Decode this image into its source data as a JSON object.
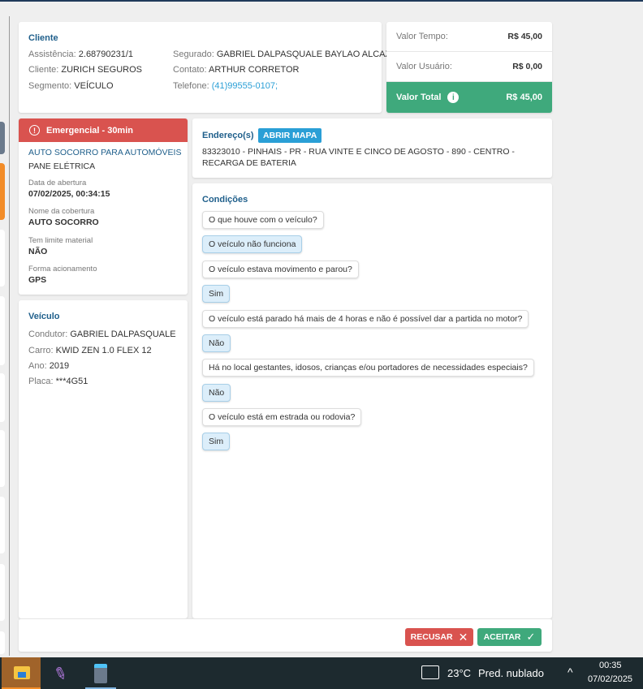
{
  "client": {
    "title": "Cliente",
    "fields": [
      {
        "label": "Assistência:",
        "value": "2.68790231/1"
      },
      {
        "label": "Cliente:",
        "value": "ZURICH SEGUROS"
      },
      {
        "label": "Segmento:",
        "value": "VEÍCULO"
      },
      {
        "label": "Segurado:",
        "value": "GABRIEL DALPASQUALE BAYLAO ALCAZAR"
      },
      {
        "label": "Contato:",
        "value": "ARTHUR CORRETOR"
      },
      {
        "label": "Telefone:",
        "value": "(41)99555-0107;"
      }
    ]
  },
  "values": {
    "tempo_label": "Valor Tempo:",
    "tempo": "R$ 45,00",
    "usuario_label": "Valor Usuário:",
    "usuario": "R$ 0,00",
    "total_label": "Valor Total",
    "total": "R$ 45,00"
  },
  "service": {
    "badge": "Emergencial - 30min",
    "title": "AUTO SOCORRO PARA AUTOMÓVEIS",
    "subtitle": "PANE ELÉTRICA",
    "fields": [
      {
        "label": "Data de abertura",
        "value": "07/02/2025, 00:34:15"
      },
      {
        "label": "Nome da cobertura",
        "value": "AUTO SOCORRO"
      },
      {
        "label": "Tem limite material",
        "value": "NÃO"
      },
      {
        "label": "Forma acionamento",
        "value": "GPS"
      }
    ]
  },
  "vehicle": {
    "title": "Veículo",
    "fields": [
      {
        "label": "Condutor:",
        "value": "GABRIEL DALPASQUALE"
      },
      {
        "label": "Carro:",
        "value": "KWID ZEN 1.0 FLEX 12"
      },
      {
        "label": "Ano:",
        "value": "2019"
      },
      {
        "label": "Placa:",
        "value": "***4G51"
      }
    ]
  },
  "address": {
    "title": "Endereço(s)",
    "map_button": "ABRIR MAPA",
    "text": "83323010 - PINHAIS - PR - RUA VINTE E CINCO DE AGOSTO - 890 - CENTRO - RECARGA DE BATERIA"
  },
  "conditions": {
    "title": "Condições",
    "items": [
      {
        "q": "O que houve com o veículo?",
        "a": "O veículo não funciona"
      },
      {
        "q": "O veículo estava movimento e parou?",
        "a": "Sim"
      },
      {
        "q": "O veículo está parado há mais de 4 horas e não é possível dar a partida no motor?",
        "a": "Não"
      },
      {
        "q": "Há no local gestantes, idosos, crianças e/ou portadores de necessidades especiais?",
        "a": "Não"
      },
      {
        "q": "O veículo está em estrada ou rodovia?",
        "a": "Sim"
      }
    ]
  },
  "actions": {
    "refuse": "RECUSAR",
    "accept": "ACEITAR"
  },
  "taskbar": {
    "temp": "23°C",
    "weather": "Pred. nublado",
    "time": "00:35",
    "date": "07/02/2025"
  },
  "colors": {
    "red": "#d9534f",
    "green": "#3fa97c",
    "blue": "#1f5f8b",
    "link": "#2a9fd6"
  }
}
